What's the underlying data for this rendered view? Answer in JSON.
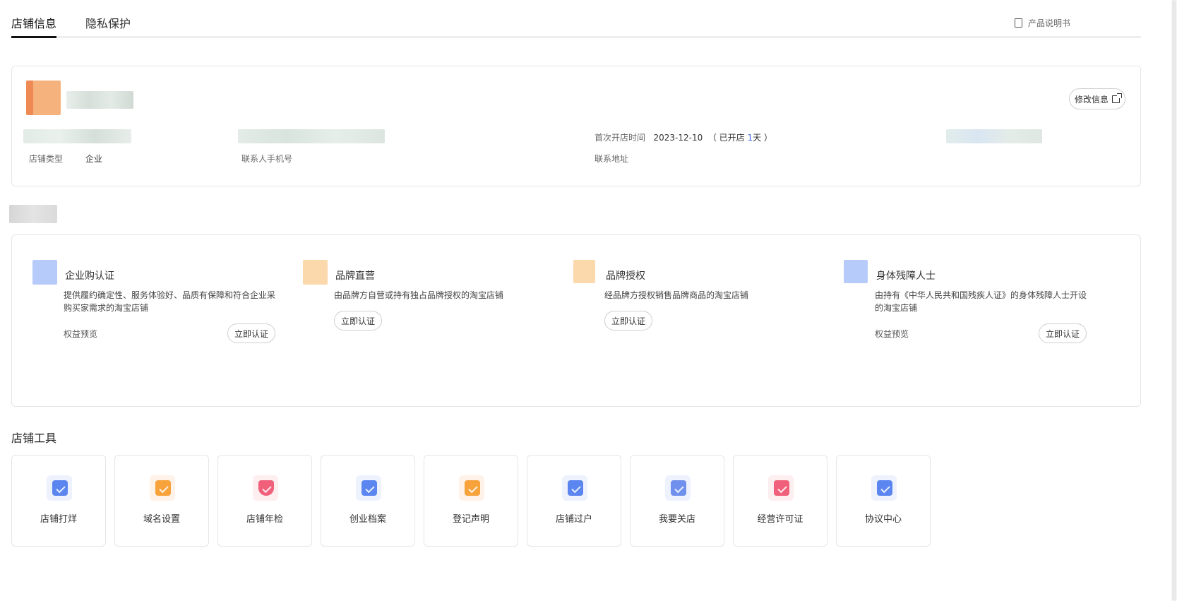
{
  "tabs": [
    {
      "label": "店铺信息",
      "active": true
    },
    {
      "label": "隐私保护",
      "active": false
    }
  ],
  "manual_link": "产品说明书",
  "info": {
    "edit_label": "修改信息",
    "store_type_label": "店铺类型",
    "store_type_value": "企业",
    "phone_label": "联系人手机号",
    "open_time_label": "首次开店时间",
    "open_time_value": "2023-12-10",
    "opened_prefix": "（ 已开店 ",
    "opened_days": "1",
    "opened_suffix": "天 ）",
    "address_label": "联系地址"
  },
  "certs": [
    {
      "title": "企业购认证",
      "desc": "提供履约确定性、服务体验好、品质有保障和符合企业采购买家需求的淘宝店铺",
      "link": "权益预览",
      "button": "立即认证",
      "color": "#b7cbfb"
    },
    {
      "title": "品牌直营",
      "desc": "由品牌方自营或持有独占品牌授权的淘宝店铺",
      "link": "",
      "button": "立即认证",
      "color": "#fcd9ad"
    },
    {
      "title": "品牌授权",
      "desc": "经品牌方授权销售品牌商品的淘宝店铺",
      "link": "",
      "button": "立即认证",
      "color": "#fcd9ad"
    },
    {
      "title": "身体残障人士",
      "desc": "由持有《中华人民共和国残疾人证》的身体残障人士开设的淘宝店铺",
      "link": "权益预览",
      "button": "立即认证",
      "color": "#b7cbfb"
    }
  ],
  "tools_title": "店铺工具",
  "tools": [
    {
      "label": "店铺打烊",
      "icon": "store-close-icon",
      "bg": "#eef2fd",
      "color": "#5b86f0"
    },
    {
      "label": "域名设置",
      "icon": "domain-icon",
      "bg": "#fff2e8",
      "color": "#f7a23b"
    },
    {
      "label": "店铺年检",
      "icon": "shield-inspect-icon",
      "bg": "#fdeef0",
      "color": "#f0607a"
    },
    {
      "label": "创业档案",
      "icon": "archive-icon",
      "bg": "#eef2fd",
      "color": "#5b86f0"
    },
    {
      "label": "登记声明",
      "icon": "register-doc-icon",
      "bg": "#fff2e8",
      "color": "#f7a23b"
    },
    {
      "label": "店铺过户",
      "icon": "transfer-icon",
      "bg": "#eef2fd",
      "color": "#5b86f0"
    },
    {
      "label": "我要关店",
      "icon": "close-store-icon",
      "bg": "#eef2fd",
      "color": "#6f90ec"
    },
    {
      "label": "经营许可证",
      "icon": "license-icon",
      "bg": "#fdeef0",
      "color": "#f0607a"
    },
    {
      "label": "协议中心",
      "icon": "agreement-icon",
      "bg": "#eef2fd",
      "color": "#5b86f0"
    }
  ]
}
